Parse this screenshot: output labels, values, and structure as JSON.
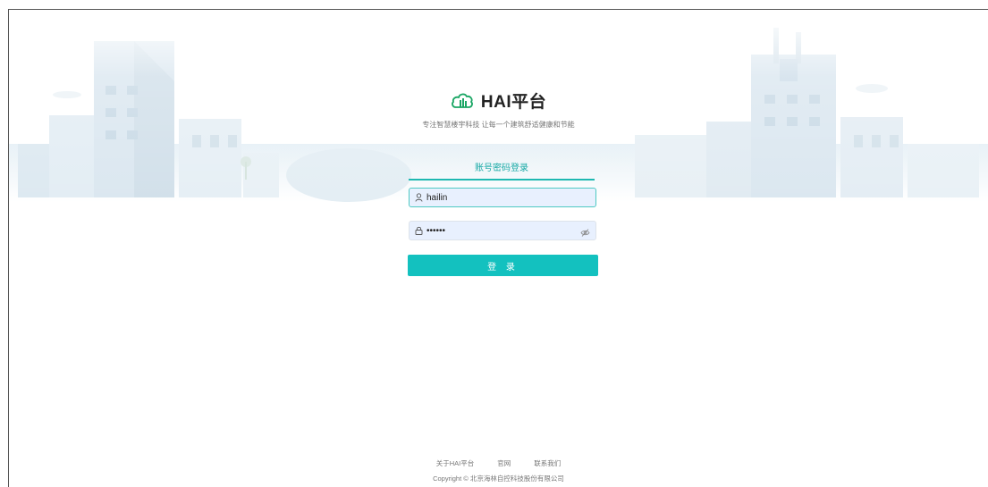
{
  "brand": {
    "title": "HAI平台",
    "slogan": "专注智慧楼宇科技 让每一个建筑舒适健康和节能",
    "logo_icon": "cloud-building-logo-icon",
    "accent_color": "#13c1bf"
  },
  "login": {
    "tab_label": "账号密码登录",
    "username_value": "hailin",
    "password_value": "••••••",
    "submit_label": "登 录",
    "icons": [
      "user-icon",
      "lock-icon",
      "eye-off-icon"
    ]
  },
  "footer": {
    "links": [
      "关于HAI平台",
      "官网",
      "联系我们"
    ],
    "copyright": "Copyright © 北京海林自控科技股份有限公司"
  }
}
